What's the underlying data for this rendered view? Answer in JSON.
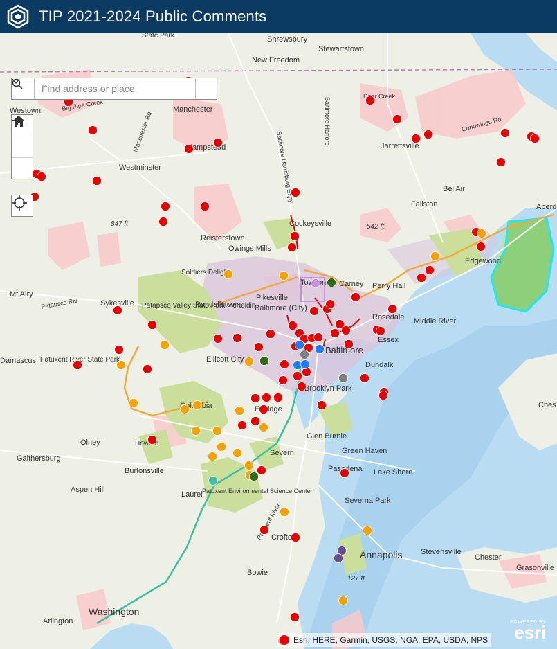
{
  "app": {
    "title": "TIP 2021-2024 Public Comments"
  },
  "search": {
    "placeholder": "Find address or place"
  },
  "attribution": {
    "text": "Esri, HERE, Garmin, USGS, NGA, EPA, USDA, NPS"
  },
  "esri_logo": {
    "powered": "POWERED BY",
    "name": "esri"
  },
  "colors": {
    "titlebar": "#0b3a63",
    "water": "#b9dcf2",
    "park": "#c9df9b",
    "urban": "#f8c9c9",
    "comment_red": "#e60000",
    "comment_orange": "#f5a200",
    "comment_blue": "#1e7bff",
    "comment_green": "#2e6b14",
    "comment_purple": "#6a4d8f",
    "comment_gray": "#808080",
    "comment_lavender": "#c88be8",
    "comment_teal": "#3bbf9f"
  },
  "place_labels": [
    "Shrewsbury",
    "Stewartstown",
    "New Freedom",
    "State Park",
    "Manchester",
    "Hampstead",
    "Westminster",
    "Jarrettsville",
    "Bel Air",
    "Fallston",
    "Cockeysville",
    "Reisterstown",
    "Owings Mills",
    "Soldiers Delight",
    "Towson",
    "Carney",
    "Perry Hall",
    "Edgewood",
    "Aberdeen",
    "Pikesville",
    "Randallstown",
    "Sykesville",
    "Mt Airy",
    "Patapsco Valley State Park McKeldin",
    "Baltimore (City)",
    "Baltimore",
    "Rosedale",
    "Middle River",
    "Essex",
    "Ellicott City",
    "Patuxent River State Park",
    "Damascus",
    "Columbia",
    "Elkridge",
    "Brooklyn Park",
    "Dundalk",
    "Olney",
    "Gaithersburg",
    "Howard",
    "Glen Burnie",
    "Green Haven",
    "Severn",
    "Burtonsville",
    "Laurel",
    "Pasadena",
    "Lake Shore",
    "Aspen Hill",
    "Patuxent Environmental Science Center",
    "Severna Park",
    "Crofton",
    "Annapolis",
    "Stevensville",
    "Chester",
    "Grasonville",
    "Bowie",
    "Arlington",
    "Washington",
    "Westown",
    "Ches"
  ],
  "road_labels": [
    "Baltimore Harrisburg Expy",
    "Baltimore Harford",
    "Conowingo Rd",
    "Manchester Rd",
    "Deer Creek",
    "Big Pipe Creek",
    "Patapsco Riv",
    "Patuxent River"
  ],
  "elevations": [
    "847 ft",
    "542 ft",
    "127 ft"
  ],
  "legend_marker": "comment"
}
